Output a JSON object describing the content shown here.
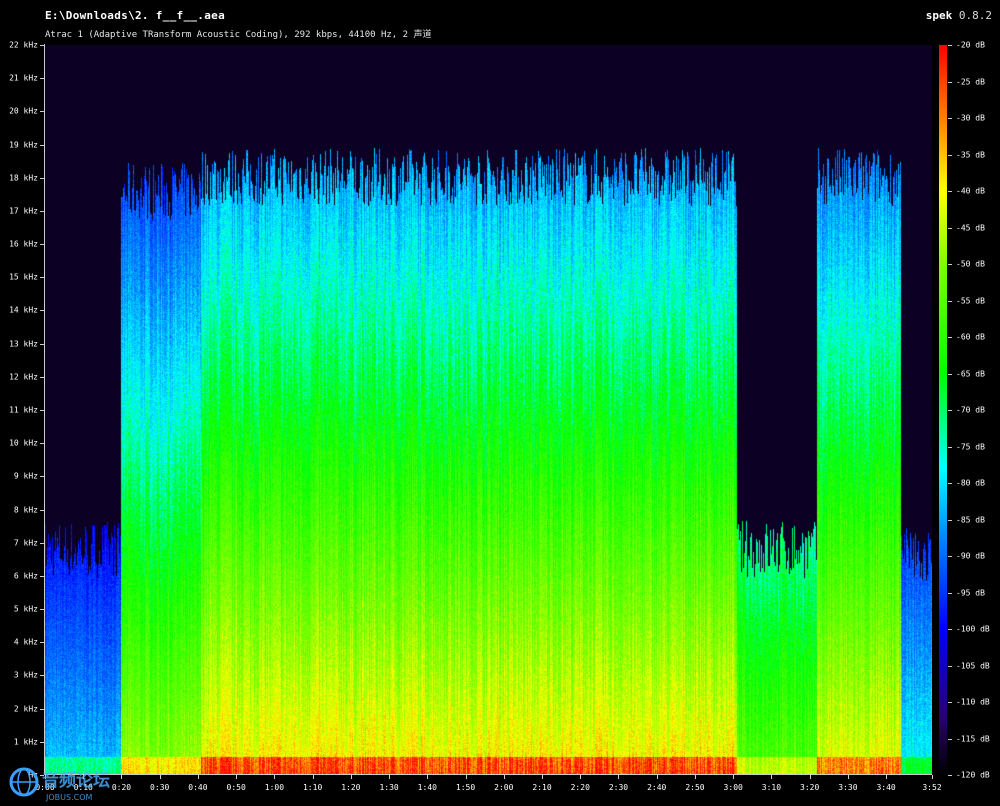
{
  "header": {
    "file_path": "E:\\Downloads\\2. f__f__.aea",
    "file_info": "Atrac 1 (Adaptive TRansform Acoustic Coding), 292 kbps, 44100 Hz, 2 声道",
    "app_name": "spek",
    "app_version": "0.8.2"
  },
  "frequency_axis": {
    "labels": [
      "22 kHz",
      "21 kHz",
      "20 kHz",
      "19 kHz",
      "18 kHz",
      "17 kHz",
      "16 kHz",
      "15 kHz",
      "14 kHz",
      "13 kHz",
      "12 kHz",
      "11 kHz",
      "10 kHz",
      "9 kHz",
      "8 kHz",
      "7 kHz",
      "6 kHz",
      "5 kHz",
      "4 kHz",
      "3 kHz",
      "2 kHz",
      "1 kHz",
      "Hz"
    ]
  },
  "time_axis": {
    "labels": [
      "0:00",
      "0:10",
      "0:20",
      "0:30",
      "0:40",
      "0:50",
      "1:00",
      "1:10",
      "1:20",
      "1:30",
      "1:40",
      "1:50",
      "2:00",
      "2:10",
      "2:20",
      "2:30",
      "2:40",
      "2:50",
      "3:00",
      "3:10",
      "3:20",
      "3:30",
      "3:40",
      "3:52"
    ]
  },
  "db_scale": {
    "labels": [
      "-20 dB",
      "-25 dB",
      "-30 dB",
      "-35 dB",
      "-40 dB",
      "-45 dB",
      "-50 dB",
      "-55 dB",
      "-60 dB",
      "-65 dB",
      "-70 dB",
      "-75 dB",
      "-80 dB",
      "-85 dB",
      "-90 dB",
      "-95 dB",
      "-100 dB",
      "-105 dB",
      "-110 dB",
      "-115 dB",
      "-120 dB"
    ]
  },
  "colors": {
    "background": "#000000",
    "axis": "#cccccc"
  },
  "watermark": {
    "text": "音频论坛",
    "subtext": "JOBUS.COM",
    "icon": "globe-logo-icon"
  }
}
